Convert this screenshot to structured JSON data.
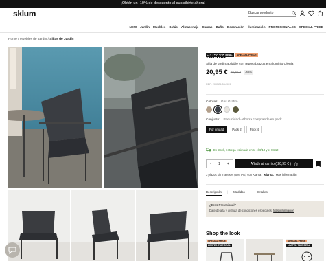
{
  "promo": {
    "text": "¡Obtén un -10% de descuento al suscribirte ahora!"
  },
  "header": {
    "logo": "sklum",
    "search_placeholder": "Buscar producto",
    "icons": [
      "menu-icon",
      "search-icon",
      "user-icon",
      "heart-icon",
      "cart-icon"
    ]
  },
  "nav": {
    "items": [
      "NEW",
      "Jardín",
      "Muebles",
      "Sofás",
      "Almacenaje",
      "Camas",
      "Baño",
      "Decoración",
      "Iluminación",
      "PROFESIONALES",
      "SPECIAL PRICE"
    ]
  },
  "breadcrumb": {
    "home": "Home",
    "sep": " / ",
    "parent": "Muebles de Jardín",
    "current": "Sillas de Jardín"
  },
  "product": {
    "badges": [
      "LIMITED TIME DEAL",
      "SPECIAL PRICE"
    ],
    "title": "Olenia",
    "subtitle": "Silla de jardín apilable con reposabrazos en aluminio Olenia",
    "price": "20,95 €",
    "old_price": "62,95 €",
    "discount": "-66%",
    "ref": "REF: 209525-564909",
    "colors_label": "Colores:",
    "color_selected": "Gris Grafito",
    "swatches": [
      "#b3a08c",
      "#3b4048",
      "#e9e6e0",
      "#5c5a3c"
    ],
    "selected_swatch_index": 1,
    "conjunto_label": "Conjunto:",
    "conjunto_value": "Por unidad - Ahorra comprando en pack",
    "conjunto_options": [
      "Por unidad",
      "Pack 2",
      "Pack 4"
    ],
    "stock_text": "En stock, entrega estimada entre el 6/10 y el 08/10",
    "qty_minus": "-",
    "qty_value": "1",
    "qty_plus": "+",
    "add_to_cart": "Añadir al carrito ( 20,95 € )",
    "installments_text": "3 plazos sin intereses (0% TAE) con Klarna.",
    "klarna": "Klarna.",
    "more_info": "Más información"
  },
  "tabs": {
    "items": [
      "Descripción",
      "Medidas",
      "Detalles"
    ],
    "sep": "|"
  },
  "pro": {
    "title": "¿Eres Profesional?",
    "text": "Date de alta y disfruta de condiciones especiales.",
    "link": "Más información"
  },
  "shop_look": {
    "title": "Shop the look",
    "cards": [
      {
        "badges": [
          "SPECIAL PRICE",
          "LIMITED TIME DEAL"
        ]
      },
      {
        "badges": []
      },
      {
        "badges": [
          "SPECIAL PRICE",
          "LIMITED TIME DEAL"
        ]
      }
    ]
  },
  "colors": {
    "accent": "#111111",
    "badge_orange": "#f0a070",
    "stock_green": "#3d8c2e",
    "pro_bg": "#ece8e1"
  }
}
